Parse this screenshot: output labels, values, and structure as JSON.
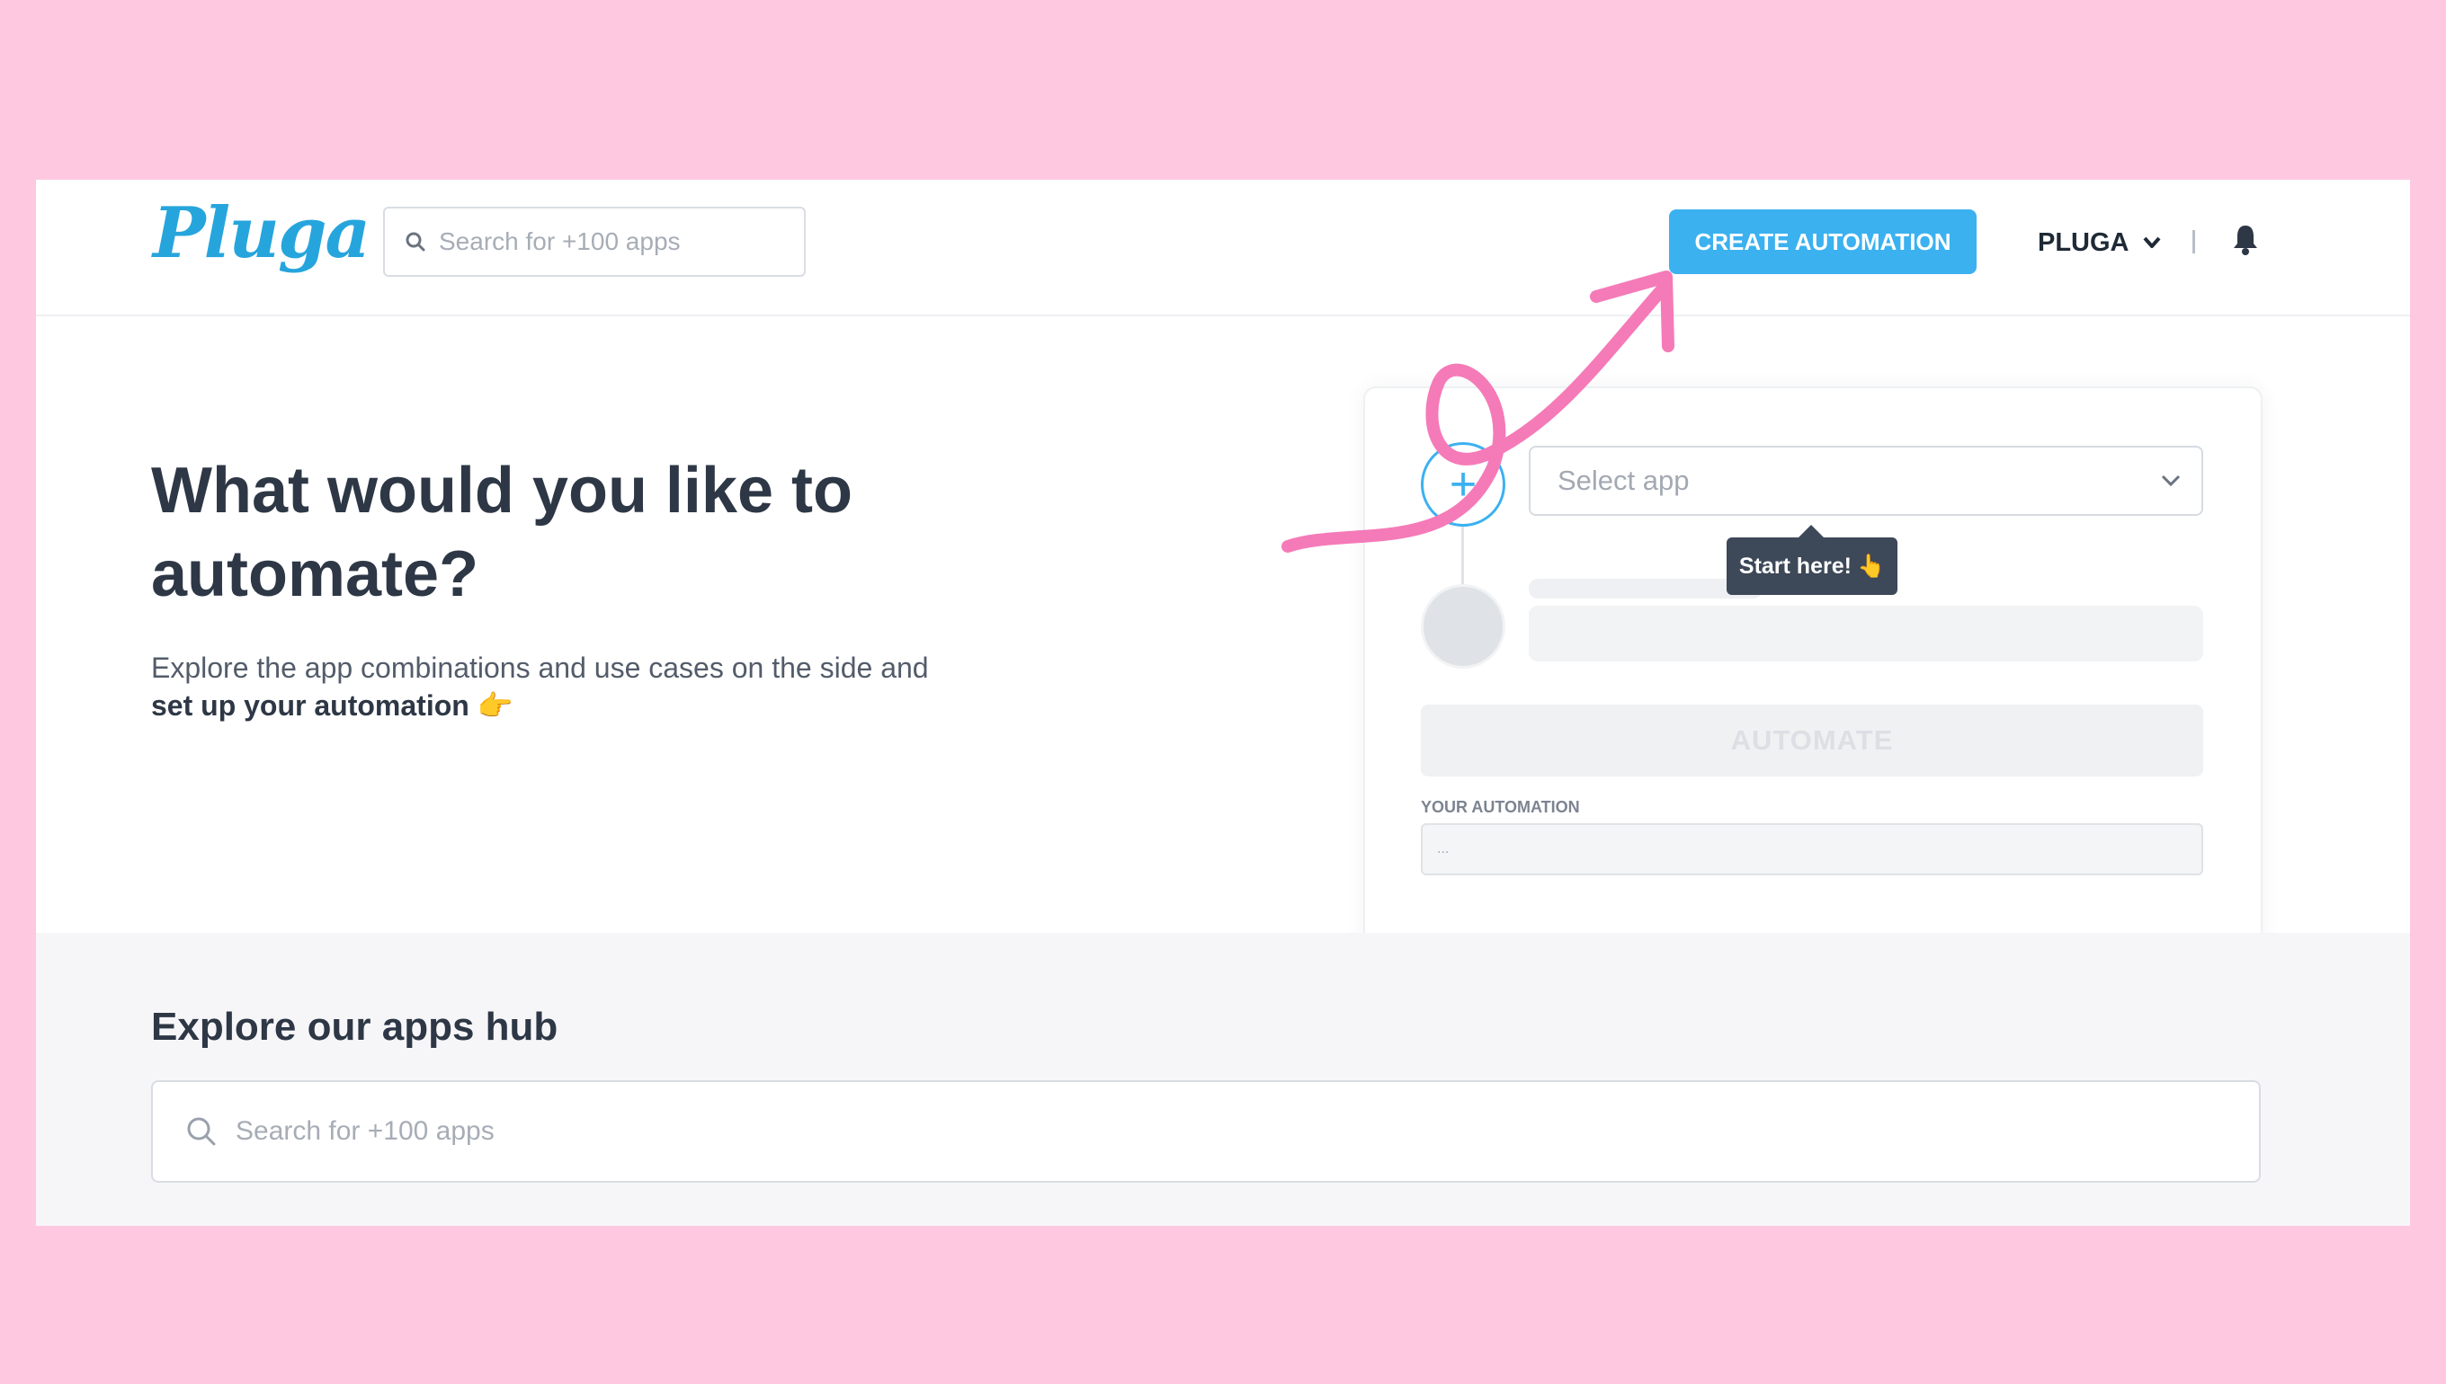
{
  "header": {
    "logo": "Pluga",
    "search_placeholder": "Search for +100 apps",
    "create_button": "CREATE AUTOMATION",
    "user_label": "PLUGA"
  },
  "hero": {
    "title": "What would you like to automate?",
    "description": "Explore the app combinations and use cases on the side and",
    "description_bold": "set up your automation",
    "pointing_emoji": "👉"
  },
  "builder": {
    "plus_symbol": "+",
    "select_placeholder": "Select app",
    "tooltip_text": "Start here!",
    "tooltip_emoji": "👆",
    "automate_button": "AUTOMATE",
    "your_automation_label": "YOUR AUTOMATION",
    "your_automation_value": "..."
  },
  "explore": {
    "title": "Explore our apps hub",
    "search_placeholder": "Search for +100 apps"
  },
  "colors": {
    "background": "#fec8e0",
    "accent": "#3bb1f0",
    "annotation": "#f57ab8"
  }
}
